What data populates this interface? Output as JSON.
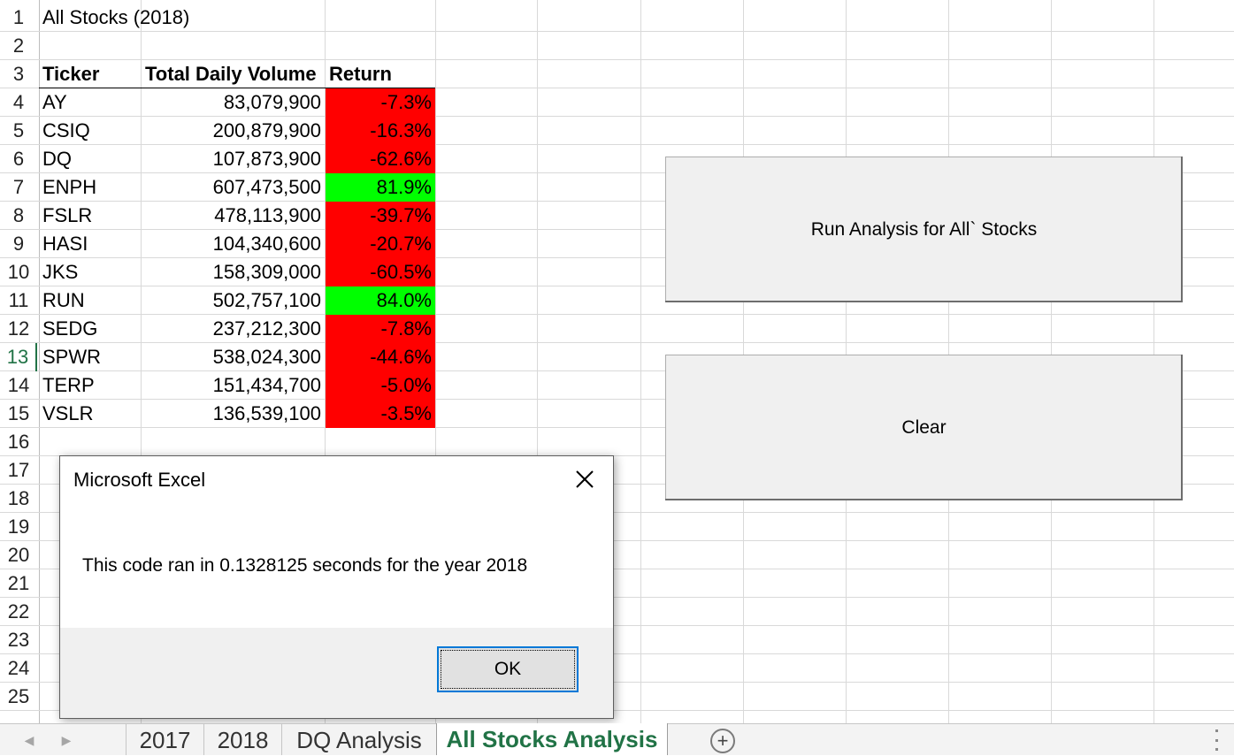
{
  "sheet": {
    "title": "All Stocks (2018)",
    "headers": {
      "ticker": "Ticker",
      "volume": "Total Daily Volume",
      "return": "Return"
    },
    "rows": [
      {
        "ticker": "AY",
        "volume": "83,079,900",
        "return": "-7.3%",
        "positive": false
      },
      {
        "ticker": "CSIQ",
        "volume": "200,879,900",
        "return": "-16.3%",
        "positive": false
      },
      {
        "ticker": "DQ",
        "volume": "107,873,900",
        "return": "-62.6%",
        "positive": false
      },
      {
        "ticker": "ENPH",
        "volume": "607,473,500",
        "return": "81.9%",
        "positive": true
      },
      {
        "ticker": "FSLR",
        "volume": "478,113,900",
        "return": "-39.7%",
        "positive": false
      },
      {
        "ticker": "HASI",
        "volume": "104,340,600",
        "return": "-20.7%",
        "positive": false
      },
      {
        "ticker": "JKS",
        "volume": "158,309,000",
        "return": "-60.5%",
        "positive": false
      },
      {
        "ticker": "RUN",
        "volume": "502,757,100",
        "return": "84.0%",
        "positive": true
      },
      {
        "ticker": "SEDG",
        "volume": "237,212,300",
        "return": "-7.8%",
        "positive": false
      },
      {
        "ticker": "SPWR",
        "volume": "538,024,300",
        "return": "-44.6%",
        "positive": false
      },
      {
        "ticker": "TERP",
        "volume": "151,434,700",
        "return": "-5.0%",
        "positive": false
      },
      {
        "ticker": "VSLR",
        "volume": "136,539,100",
        "return": "-3.5%",
        "positive": false
      }
    ],
    "row_numbers": [
      "1",
      "2",
      "3",
      "4",
      "5",
      "6",
      "7",
      "8",
      "9",
      "10",
      "11",
      "12",
      "13",
      "14",
      "15",
      "16",
      "17",
      "18",
      "19",
      "20",
      "21",
      "22",
      "23",
      "24",
      "25"
    ],
    "active_row": "13",
    "colors": {
      "negative": "#ff0000",
      "positive": "#00ff00",
      "accent": "#217346",
      "focus": "#0078d7"
    }
  },
  "buttons": {
    "run": "Run Analysis for All` Stocks",
    "clear": "Clear"
  },
  "dialog": {
    "title": "Microsoft Excel",
    "message": "This code ran in 0.1328125 seconds for the year 2018",
    "ok": "OK",
    "close_icon": "close-icon"
  },
  "tabs": {
    "items": [
      "2017",
      "2018",
      "DQ Analysis",
      "All Stocks Analysis"
    ],
    "active": "All Stocks Analysis",
    "add_icon": "plus-circle-icon"
  }
}
